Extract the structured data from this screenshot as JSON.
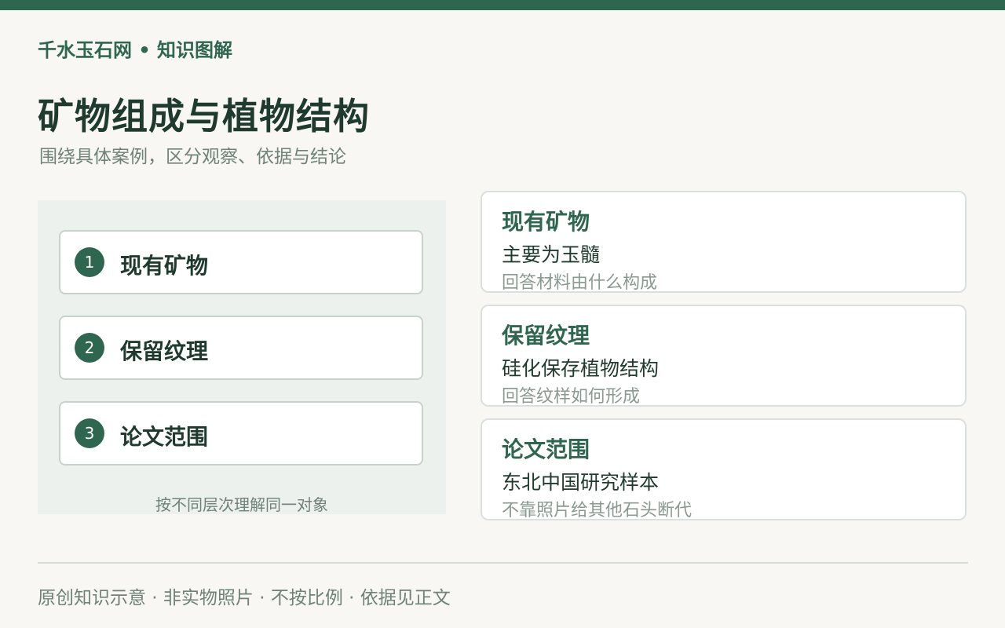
{
  "brand": "千水玉石网 • 知识图解",
  "title": "矿物组成与植物结构",
  "subtitle": "围绕具体案例，区分观察、依据与结论",
  "layers": [
    {
      "number": "1",
      "label": "现有矿物"
    },
    {
      "number": "2",
      "label": "保留纹理"
    },
    {
      "number": "3",
      "label": "论文范围"
    }
  ],
  "panel_caption": "按不同层次理解同一对象",
  "cards": [
    {
      "title": "现有矿物",
      "desc": "主要为玉髓",
      "note": "回答材料由什么构成"
    },
    {
      "title": "保留纹理",
      "desc": "硅化保存植物结构",
      "note": "回答纹样如何形成"
    },
    {
      "title": "论文范围",
      "desc": "东北中国研究样本",
      "note": "不靠照片给其他石头断代"
    }
  ],
  "footer": "原创知识示意 · 非实物照片 · 不按比例 · 依据见正文",
  "colors": {
    "accent": "#2f6650",
    "background": "#f8f7f3",
    "panel": "#edf1ed"
  }
}
